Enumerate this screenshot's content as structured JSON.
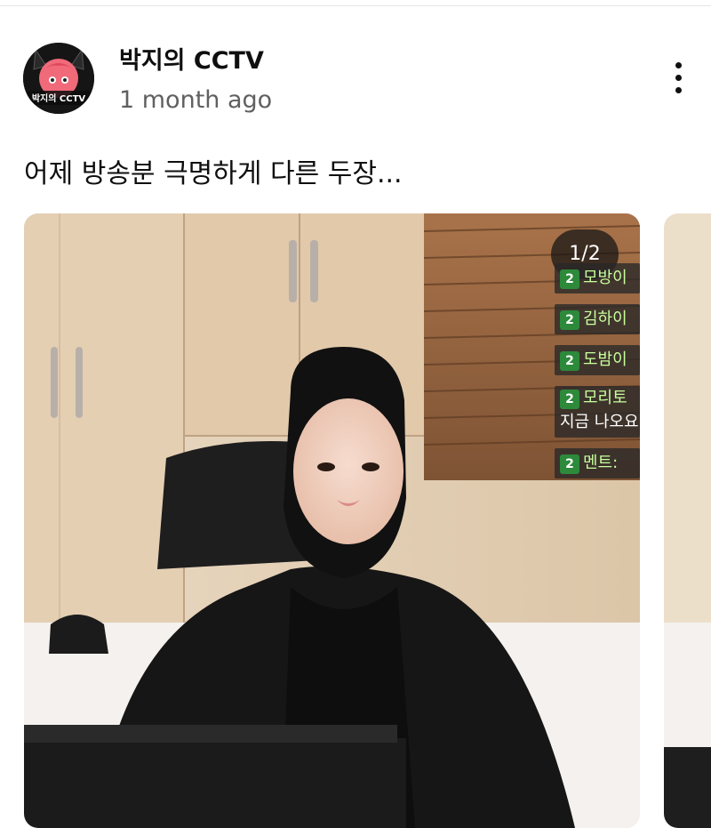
{
  "post": {
    "channel_name": "박지의 CCTV",
    "time_ago": "1 month ago",
    "text": "어제 방송분 극명하게 다른 두장...",
    "avatar_text": "박지의 CCTV"
  },
  "carousel": {
    "counter": "1/2",
    "chat": [
      {
        "badge": "2",
        "name": "모방이"
      },
      {
        "badge": "2",
        "name": "김하이"
      },
      {
        "badge": "2",
        "name": "도밤이"
      },
      {
        "badge": "2",
        "name": "모리토",
        "message": "지금 나오요"
      },
      {
        "badge": "2",
        "name": "멘트:"
      }
    ]
  },
  "icons": {
    "more": "more-vertical-icon"
  }
}
